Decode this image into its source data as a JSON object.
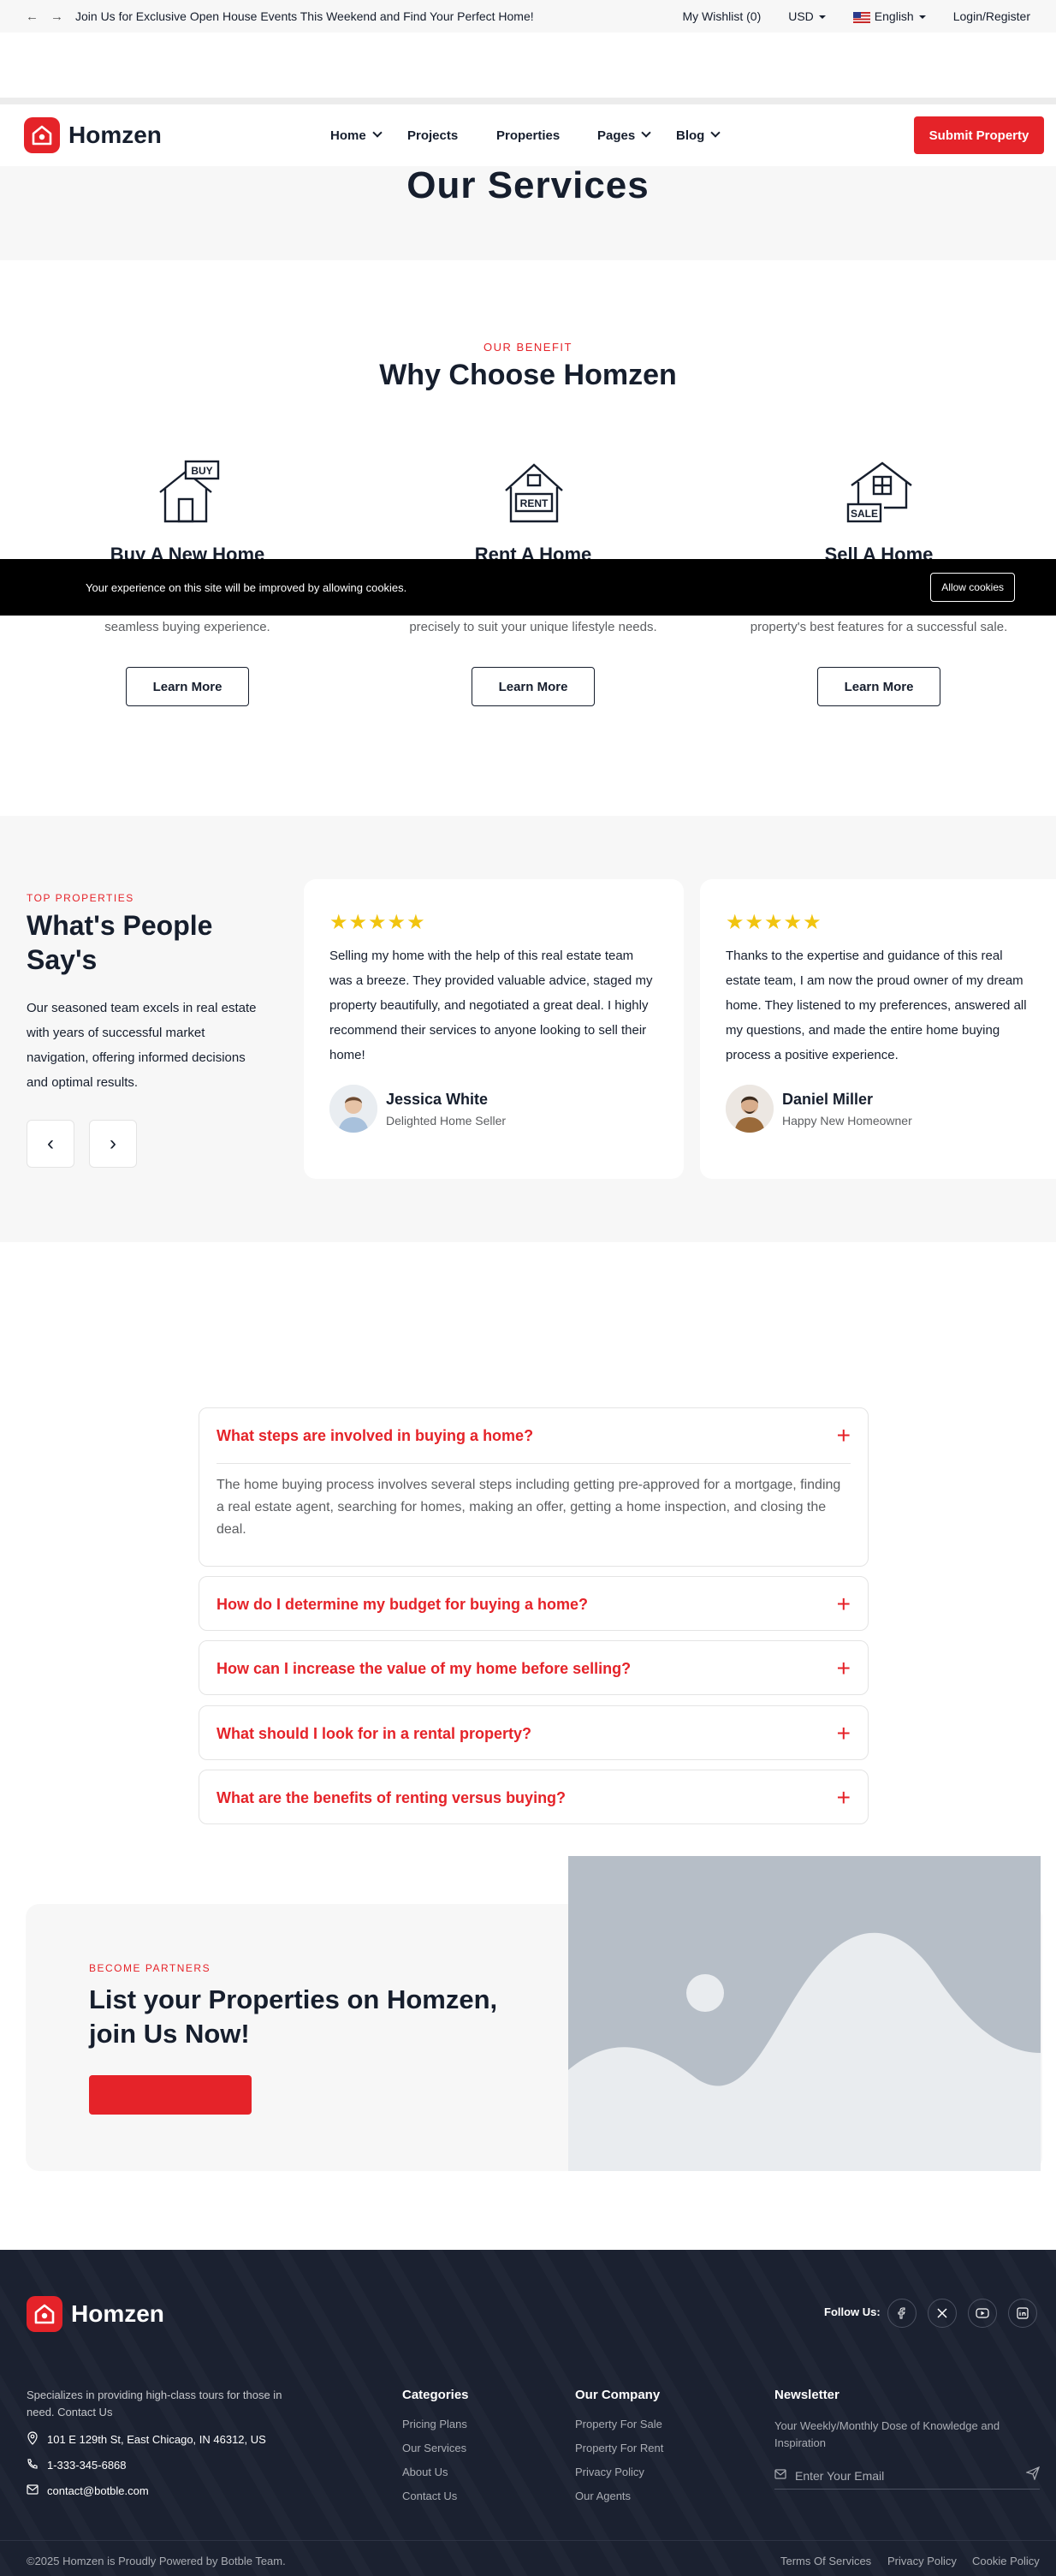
{
  "topbar": {
    "announcement": "Join Us for Exclusive Open House Events This Weekend and Find Your Perfect Home!",
    "wishlist": "My Wishlist (0)",
    "currency": "USD",
    "language": "English",
    "login": "Login/Register"
  },
  "header": {
    "brand": "Homzen",
    "nav": [
      "Home",
      "Projects",
      "Properties",
      "Pages",
      "Blog"
    ],
    "submit": "Submit Property"
  },
  "banner": {
    "title": "Our Services"
  },
  "benefit": {
    "eyebrow": "OUR BENEFIT",
    "title": "Why Choose Homzen",
    "cards": [
      {
        "icon": "buy-house-icon",
        "sign": "BUY",
        "title": "Buy A New Home",
        "text": "seamless buying experience.",
        "button": "Learn More"
      },
      {
        "icon": "rent-house-icon",
        "sign": "RENT",
        "title": "Rent A Home",
        "text": "precisely to suit your unique lifestyle needs.",
        "button": "Learn More"
      },
      {
        "icon": "sale-house-icon",
        "sign": "SALE",
        "title": "Sell A Home",
        "text": "property's best features for a successful sale.",
        "button": "Learn More"
      }
    ]
  },
  "cookie": {
    "message": "Your experience on this site will be improved by allowing cookies.",
    "button": "Allow cookies"
  },
  "testimonials": {
    "eyebrow": "TOP PROPERTIES",
    "title": "What's People Say's",
    "text": "Our seasoned team excels in real estate with years of successful market navigation, offering informed decisions and optimal results.",
    "stars": "★★★★★",
    "items": [
      {
        "quote": "Selling my home with the help of this real estate team was a breeze. They provided valuable advice, staged my property beautifully, and negotiated a great deal. I highly recommend their services to anyone looking to sell their home!",
        "name": "Jessica White",
        "role": "Delighted Home Seller"
      },
      {
        "quote": "Thanks to the expertise and guidance of this real estate team, I am now the proud owner of my dream home. They listened to my preferences, answered all my questions, and made the entire home buying process a positive experience.",
        "name": "Daniel Miller",
        "role": "Happy New Homeowner"
      }
    ]
  },
  "faq": {
    "items": [
      {
        "q": "What steps are involved in buying a home?",
        "a": "The home buying process involves several steps including getting pre-approved for a mortgage, finding a real estate agent, searching for homes, making an offer, getting a home inspection, and closing the deal."
      },
      {
        "q": "How do I determine my budget for buying a home?"
      },
      {
        "q": "How can I increase the value of my home before selling?"
      },
      {
        "q": "What should I look for in a rental property?"
      },
      {
        "q": "What are the benefits of renting versus buying?"
      }
    ],
    "icon": "+"
  },
  "cta": {
    "eyebrow": "BECOME PARTNERS",
    "title": "List your Properties on Homzen, join Us Now!",
    "button": ""
  },
  "footer": {
    "brand": "Homzen",
    "follow": "Follow Us:",
    "social": [
      "facebook-icon",
      "x-icon",
      "youtube-icon",
      "linkedin-icon"
    ],
    "about": "Specializes in providing high-class tours for those in need. Contact Us",
    "address": "101 E 129th St, East Chicago, IN 46312, US",
    "phone": "1-333-345-6868",
    "email": "contact@botble.com",
    "categories": {
      "title": "Categories",
      "links": [
        "Pricing Plans",
        "Our Services",
        "About Us",
        "Contact Us"
      ]
    },
    "company": {
      "title": "Our Company",
      "links": [
        "Property For Sale",
        "Property For Rent",
        "Privacy Policy",
        "Our Agents"
      ]
    },
    "newsletter": {
      "title": "Newsletter",
      "text": "Your Weekly/Monthly Dose of Knowledge and Inspiration",
      "placeholder": "Enter Your Email"
    },
    "copyright": "©2025 Homzen is Proudly Powered by Botble Team.",
    "bottom_links": [
      "Terms Of Services",
      "Privacy Policy",
      "Cookie Policy"
    ]
  },
  "colors": {
    "brand": "#e52329",
    "dark": "#161e2d",
    "footer": "#1b2130"
  }
}
